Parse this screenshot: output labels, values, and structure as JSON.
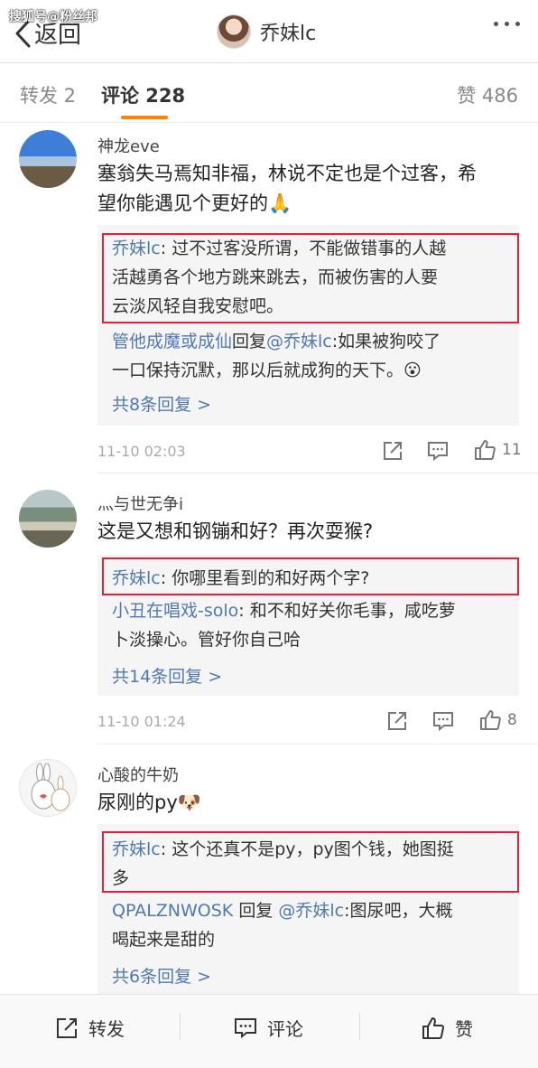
{
  "watermark": "搜狐号@粉丝邦",
  "nav": {
    "back_label": "返回",
    "title": "乔妹lc"
  },
  "tabs": {
    "repost": "转发 2",
    "comment": "评论 228",
    "like": "赞 486"
  },
  "comments": [
    {
      "name": "神龙eve",
      "text_line1": "塞翁失马焉知非福，林说不定也是个过客，希",
      "text_line2": "望你能遇见个更好的🙏",
      "replies": [
        {
          "author": "乔妹lc",
          "sep": ": ",
          "line1": "过不过客没所谓，不能做错事的人越",
          "line2": "活越勇各个地方跳来跳去，而被伤害的人要",
          "line3": "云淡风轻自我安慰吧。"
        },
        {
          "author": "管他成魔或成仙",
          "mid": "回复",
          "at": "@乔妹lc",
          "line1": ":如果被狗咬了",
          "line2": "一口保持沉默，那以后就成狗的天下。😮"
        }
      ],
      "more": "共8条回复 >",
      "time": "11-10 02:03",
      "likes": "11"
    },
    {
      "name": "灬与世无争i",
      "text_line1": "这是又想和钢镚和好？再次耍猴?",
      "replies": [
        {
          "author": "乔妹lc",
          "sep": ": ",
          "line1": "你哪里看到的和好两个字?"
        },
        {
          "author": "小丑在唱戏-solo",
          "sep": ": ",
          "line1": "和不和好关你毛事，咸吃萝",
          "line2": "卜淡操心。管好你自己哈"
        }
      ],
      "more": "共14条回复 >",
      "time": "11-10 01:24",
      "likes": "8"
    },
    {
      "name": "心酸的牛奶",
      "text_line1": "尿刚的py🐶",
      "replies": [
        {
          "author": "乔妹lc",
          "sep": ": ",
          "line1": "这个还真不是py，py图个钱，她图挺",
          "line2": "多"
        },
        {
          "author": "QPALZNWOSK",
          "mid": " 回复 ",
          "at": "@乔妹lc",
          "line1": ":图尿吧，大概",
          "line2": "喝起来是甜的"
        }
      ],
      "more": "共6条回复 >"
    }
  ],
  "footer": {
    "repost": "转发",
    "comment": "评论",
    "like": "赞"
  },
  "colors": {
    "accent": "#ff8200",
    "link": "#4f78b3",
    "highlight_frame": "#e5203a"
  }
}
